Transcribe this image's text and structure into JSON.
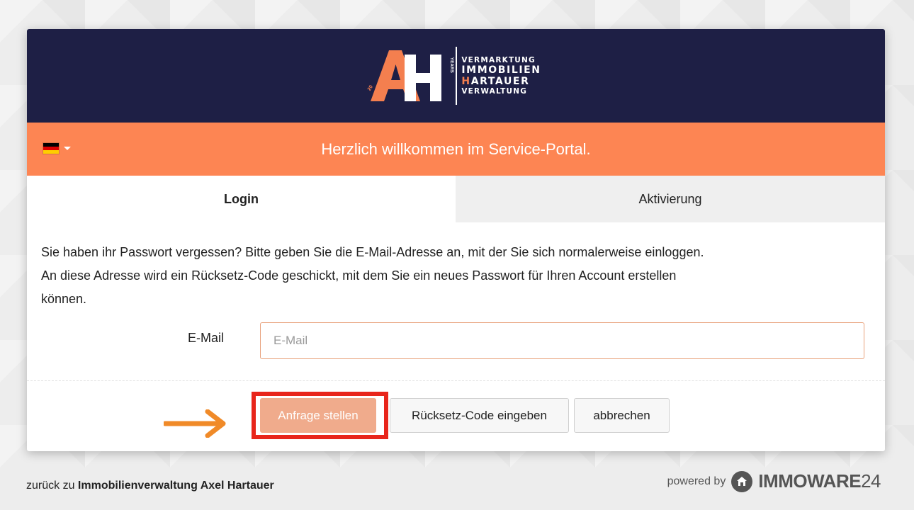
{
  "logo": {
    "letters": "AH",
    "line1": "VERMARKTUNG",
    "line2": "IMMOBILIEN",
    "line3_first": "H",
    "line3_rest": "ARTAUER",
    "line4": "VERWALTUNG",
    "years_label": "YEARS",
    "year_label": "20"
  },
  "banner": {
    "language_flag": "german-flag",
    "title": "Herzlich willkommen im Service-Portal."
  },
  "tabs": [
    {
      "label": "Login",
      "active": true
    },
    {
      "label": "Aktivierung",
      "active": false
    }
  ],
  "instructions": {
    "line1": "Sie haben ihr Passwort vergessen? Bitte geben Sie die E-Mail-Adresse an, mit der Sie sich normalerweise einloggen.",
    "line2": "An diese Adresse wird ein Rücksetz-Code geschickt, mit dem Sie ein neues Passwort für Ihren Account erstellen",
    "line3": "können."
  },
  "form": {
    "email_label": "E-Mail",
    "email_placeholder": "E-Mail",
    "email_value": ""
  },
  "buttons": {
    "submit": "Anfrage stellen",
    "enter_code": "Rücksetz-Code eingeben",
    "cancel": "abbrechen"
  },
  "footer": {
    "back_prefix": "zurück zu",
    "back_link": "Immobilienverwaltung Axel Hartauer",
    "powered_by": "powered by",
    "brand_bold": "IMMOWARE",
    "brand_light": "24"
  },
  "colors": {
    "header_bg": "#1e1f45",
    "banner_bg": "#fd8553",
    "accent_orange": "#f47f4f",
    "primary_button": "#f0ab8c",
    "highlight_red": "#e8251b",
    "arrow_orange": "#f08a28"
  }
}
